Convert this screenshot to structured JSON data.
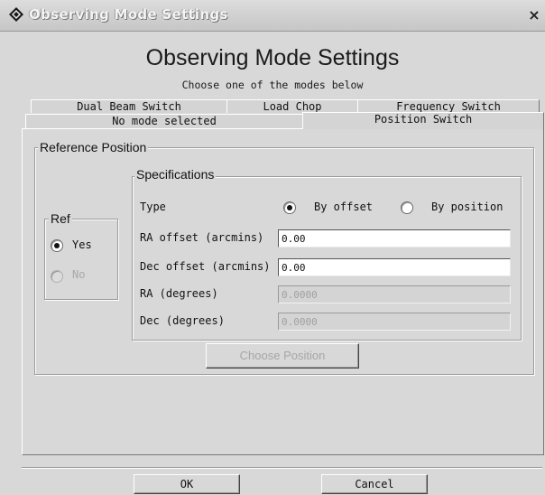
{
  "window": {
    "title": "Observing Mode Settings",
    "close_glyph": "×",
    "app_icon": "diamond-app-icon"
  },
  "header": {
    "title": "Observing Mode Settings",
    "subtitle": "Choose one of the modes below"
  },
  "tabs": {
    "row1": [
      "Dual Beam Switch",
      "Load Chop",
      "Frequency Switch"
    ],
    "row2": [
      "No mode selected",
      "Position Switch"
    ],
    "selected": "Position Switch"
  },
  "reference_position": {
    "legend": "Reference Position",
    "ref": {
      "legend": "Ref",
      "yes_label": "Yes",
      "no_label": "No",
      "selected": "Yes"
    },
    "specifications": {
      "legend": "Specifications",
      "type_label": "Type",
      "by_offset_label": "By offset",
      "by_position_label": "By position",
      "type_selected": "By offset",
      "ra_offset_label": "RA offset (arcmins)",
      "ra_offset_value": "0.00",
      "dec_offset_label": "Dec offset (arcmins)",
      "dec_offset_value": "0.00",
      "ra_degrees_label": "RA (degrees)",
      "ra_degrees_value": "0.0000",
      "dec_degrees_label": "Dec (degrees)",
      "dec_degrees_value": "0.0000"
    },
    "choose_position_label": "Choose Position"
  },
  "footer": {
    "ok_label": "OK",
    "cancel_label": "Cancel"
  }
}
